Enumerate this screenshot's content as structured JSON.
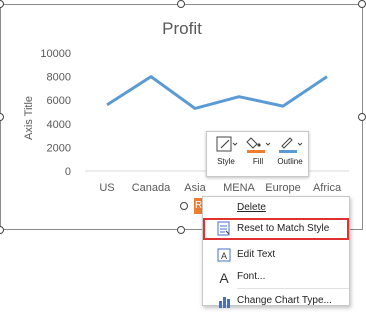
{
  "chart_data": {
    "type": "line",
    "title": "Profit",
    "xlabel": "",
    "ylabel": "Axis Title",
    "categories": [
      "US",
      "Canada",
      "Asia",
      "MENA",
      "Europe",
      "Africa"
    ],
    "series": [
      {
        "values": [
          5600,
          8000,
          5300,
          6300,
          5500,
          8000
        ]
      }
    ],
    "yticks": [
      "0",
      "2000",
      "4000",
      "6000",
      "8000",
      "10000"
    ],
    "ylim": [
      0,
      10000
    ],
    "grid": false,
    "line_color": "#5b9bd5"
  },
  "mini_toolbar": {
    "style_label": "Style",
    "fill_label": "Fill",
    "outline_label": "Outline",
    "fill_color": "#ed7d31",
    "outline_color": "#5b9bd5"
  },
  "legend_chip": {
    "text": "Re"
  },
  "context_menu": {
    "items": [
      {
        "label": "Delete",
        "icon": "delete-icon"
      },
      {
        "label": "Reset to Match Style",
        "icon": "reset-style-icon"
      },
      {
        "label": "Edit Text",
        "icon": "edit-text-icon"
      },
      {
        "label": "Font...",
        "icon": "font-icon"
      },
      {
        "label": "Change Chart Type...",
        "icon": "chart-type-icon"
      }
    ]
  },
  "colors": {
    "highlight_border": "#e03131",
    "selection_handle": "#444444"
  }
}
